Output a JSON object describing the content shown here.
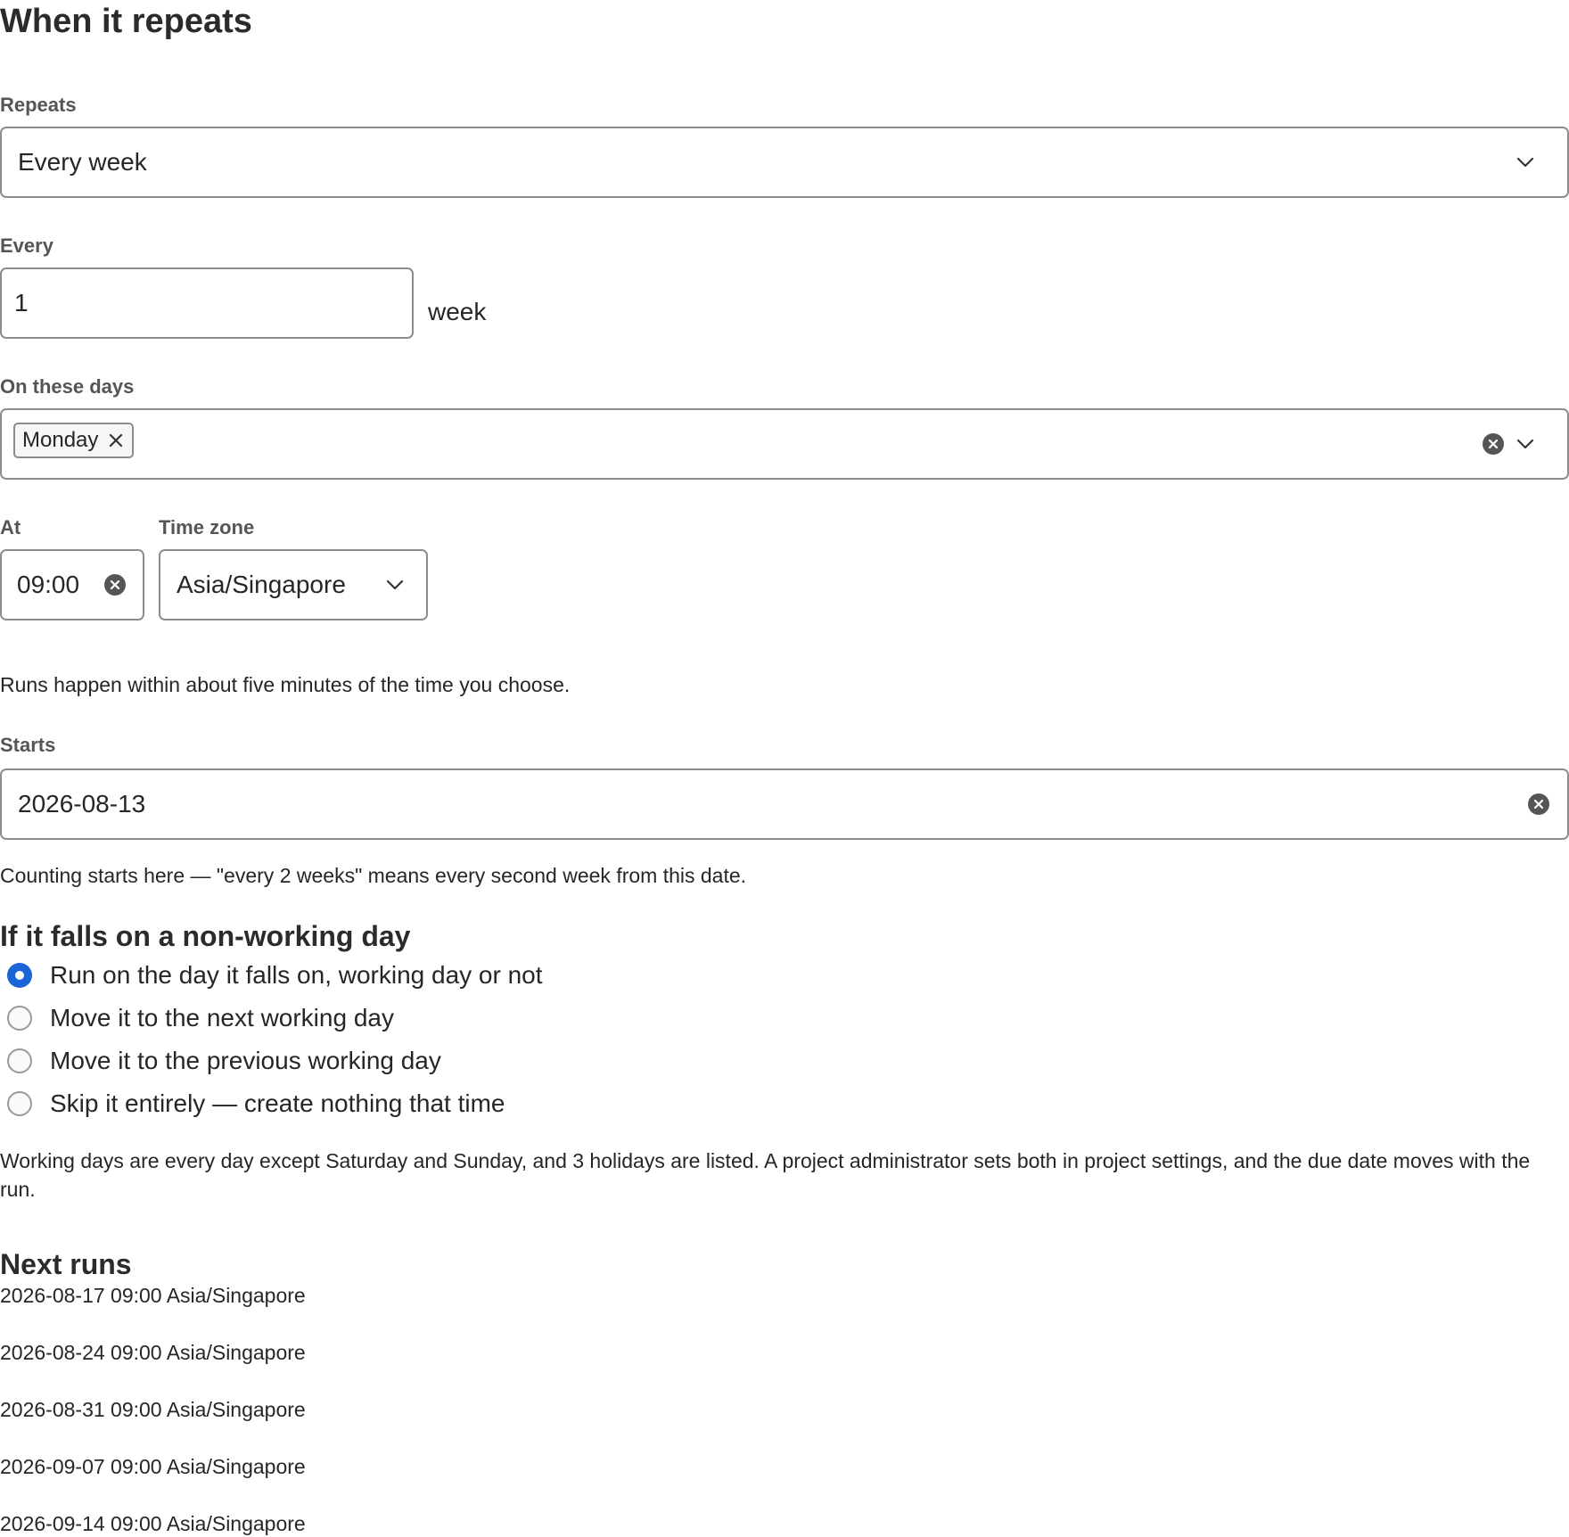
{
  "section": {
    "title": "When it repeats"
  },
  "repeats": {
    "label": "Repeats",
    "value": "Every week",
    "icon": "chevron-down-icon"
  },
  "every": {
    "label": "Every",
    "value": "1",
    "unit": "week"
  },
  "days": {
    "label": "On these days",
    "selected": [
      "Monday"
    ],
    "icons": [
      "close-icon",
      "clear-icon",
      "chevron-down-icon"
    ]
  },
  "at": {
    "label": "At",
    "value": "09:00"
  },
  "timezone": {
    "label": "Time zone",
    "value": "Asia/Singapore"
  },
  "time_hint": "Runs happen within about five minutes of the time you choose.",
  "starts": {
    "label": "Starts",
    "value": "2026-08-13",
    "hint": "Counting starts here — \"every 2 weeks\" means every second week from this date."
  },
  "non_working": {
    "title": "If it falls on a non-working day",
    "options": [
      {
        "label": "Run on the day it falls on, working day or not",
        "checked": true
      },
      {
        "label": "Move it to the next working day",
        "checked": false
      },
      {
        "label": "Move it to the previous working day",
        "checked": false
      },
      {
        "label": "Skip it entirely — create nothing that time",
        "checked": false
      }
    ],
    "note": "Working days are every day except Saturday and Sunday, and 3 holidays are listed. A project administrator sets both in project settings, and the due date moves with the run."
  },
  "next_runs": {
    "title": "Next runs",
    "items": [
      "2026-08-17 09:00 Asia/Singapore",
      "2026-08-24 09:00 Asia/Singapore",
      "2026-08-31 09:00 Asia/Singapore",
      "2026-09-07 09:00 Asia/Singapore",
      "2026-09-14 09:00 Asia/Singapore"
    ]
  },
  "colors": {
    "accent": "#1a66d6",
    "border": "#8c8c8c",
    "label": "#555555",
    "text": "#262626"
  }
}
